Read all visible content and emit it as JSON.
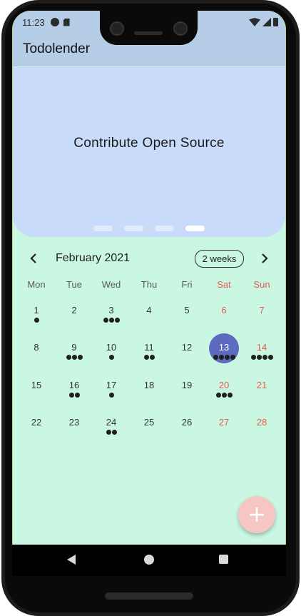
{
  "status_bar": {
    "time": "11:23"
  },
  "app_bar": {
    "title": "Todolender"
  },
  "banner": {
    "text": "Contribute Open Source",
    "page_count": 4,
    "active_page": 3,
    "background": "#c8dbfb"
  },
  "calendar": {
    "month_title": "February 2021",
    "format_button": "2 weeks",
    "weekdays": [
      "Mon",
      "Tue",
      "Wed",
      "Thu",
      "Fri",
      "Sat",
      "Sun"
    ],
    "selected_color": "#5c6bc0",
    "weekend_color": "#e55b4c",
    "weeks": [
      [
        {
          "day": "1",
          "events": 1
        },
        {
          "day": "2",
          "events": 0
        },
        {
          "day": "3",
          "events": 3
        },
        {
          "day": "4",
          "events": 0
        },
        {
          "day": "5",
          "events": 0
        },
        {
          "day": "6",
          "events": 0
        },
        {
          "day": "7",
          "events": 0
        }
      ],
      [
        {
          "day": "8",
          "events": 0
        },
        {
          "day": "9",
          "events": 3
        },
        {
          "day": "10",
          "events": 1
        },
        {
          "day": "11",
          "events": 2
        },
        {
          "day": "12",
          "events": 0
        },
        {
          "day": "13",
          "events": 4,
          "selected": true
        },
        {
          "day": "14",
          "events": 4
        }
      ],
      [
        {
          "day": "15",
          "events": 0
        },
        {
          "day": "16",
          "events": 2
        },
        {
          "day": "17",
          "events": 1
        },
        {
          "day": "18",
          "events": 0
        },
        {
          "day": "19",
          "events": 0
        },
        {
          "day": "20",
          "events": 3
        },
        {
          "day": "21",
          "events": 0
        }
      ],
      [
        {
          "day": "22",
          "events": 0
        },
        {
          "day": "23",
          "events": 0
        },
        {
          "day": "24",
          "events": 2
        },
        {
          "day": "25",
          "events": 0
        },
        {
          "day": "26",
          "events": 0
        },
        {
          "day": "27",
          "events": 0
        },
        {
          "day": "28",
          "events": 0
        }
      ]
    ]
  },
  "fab": {
    "icon": "plus-icon",
    "color": "#f5c6c2"
  },
  "navigation": {
    "icons": [
      "back-icon",
      "home-icon",
      "recents-icon"
    ]
  }
}
